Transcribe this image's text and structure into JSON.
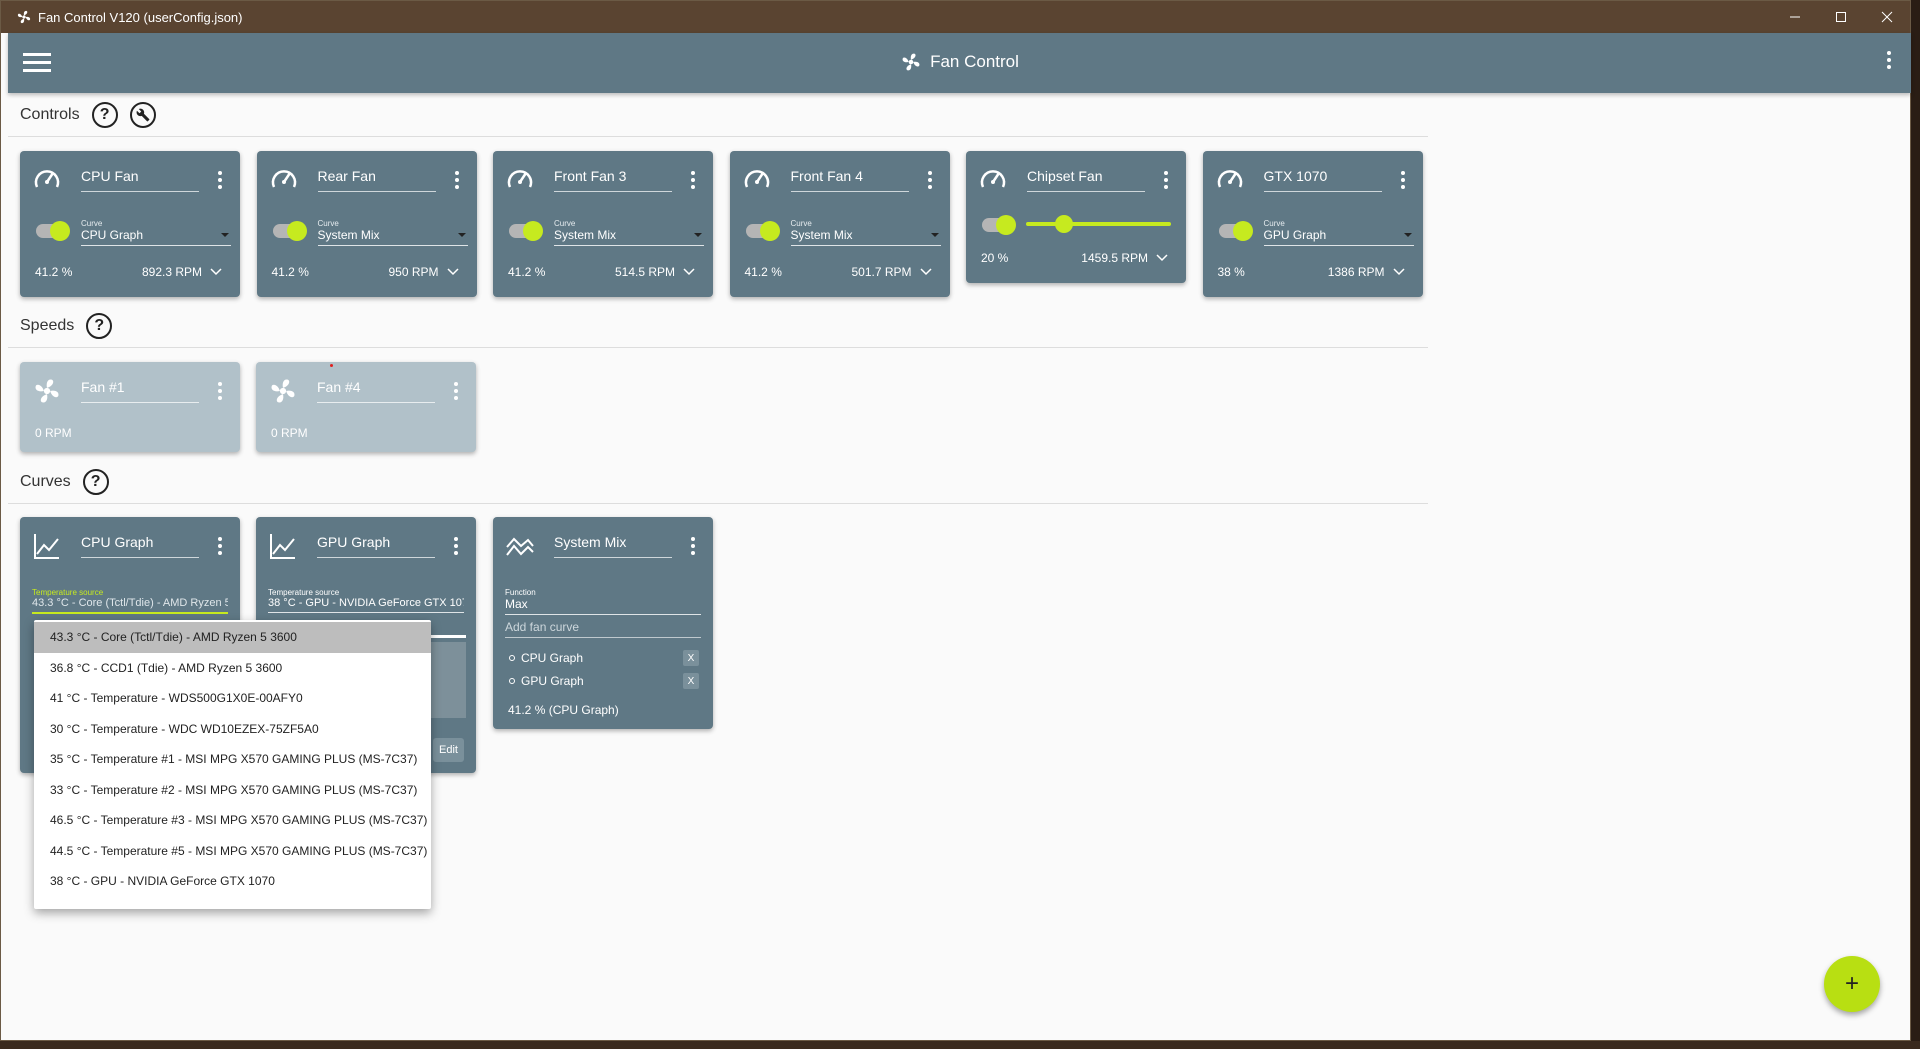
{
  "window": {
    "title": "Fan Control V120 (userConfig.json)"
  },
  "appbar": {
    "title": "Fan Control"
  },
  "sections": {
    "controls": "Controls",
    "speeds": "Speeds",
    "curves": "Curves"
  },
  "controls": [
    {
      "name": "CPU Fan",
      "curve_caption": "Curve",
      "curve": "CPU Graph",
      "percent": "41.2 %",
      "rpm": "892.3 RPM"
    },
    {
      "name": "Rear Fan",
      "curve_caption": "Curve",
      "curve": "System Mix",
      "percent": "41.2 %",
      "rpm": "950 RPM"
    },
    {
      "name": "Front Fan 3",
      "curve_caption": "Curve",
      "curve": "System Mix",
      "percent": "41.2 %",
      "rpm": "514.5 RPM"
    },
    {
      "name": "Front Fan 4",
      "curve_caption": "Curve",
      "curve": "System Mix",
      "percent": "41.2 %",
      "rpm": "501.7 RPM"
    },
    {
      "name": "Chipset Fan",
      "percent": "20 %",
      "rpm": "1459.5 RPM",
      "slider_fraction": 0.2
    },
    {
      "name": "GTX 1070",
      "curve_caption": "Curve",
      "curve": "GPU Graph",
      "percent": "38 %",
      "rpm": "1386 RPM"
    }
  ],
  "speeds": [
    {
      "name": "Fan #1",
      "rpm": "0 RPM"
    },
    {
      "name": "Fan #4",
      "rpm": "0 RPM"
    }
  ],
  "curves": {
    "cpu_graph": {
      "name": "CPU Graph",
      "source_caption": "Temperature source",
      "source": "43.3 °C - Core (Tctl/Tdie) - AMD Ryzen 5 3600"
    },
    "gpu_graph": {
      "name": "GPU Graph",
      "source_caption": "Temperature source",
      "source": "38 °C - GPU - NVIDIA GeForce GTX 1070",
      "edit_label": "Edit"
    },
    "system_mix": {
      "name": "System Mix",
      "function_caption": "Function",
      "function": "Max",
      "add_placeholder": "Add fan curve",
      "items": [
        "CPU Graph",
        "GPU Graph"
      ],
      "remove_label": "X",
      "output": "41.2 % (CPU Graph)"
    }
  },
  "dropdown": {
    "options": [
      "43.3 °C - Core (Tctl/Tdie) - AMD Ryzen 5 3600",
      "36.8 °C - CCD1 (Tdie) - AMD Ryzen 5 3600",
      "41 °C - Temperature - WDS500G1X0E-00AFY0",
      "30 °C - Temperature - WDC WD10EZEX-75ZF5A0",
      "35 °C - Temperature #1 - MSI MPG X570 GAMING PLUS (MS-7C37)",
      "33 °C - Temperature #2 - MSI MPG X570 GAMING PLUS (MS-7C37)",
      "46.5 °C - Temperature #3 - MSI MPG X570 GAMING PLUS (MS-7C37)",
      "44.5 °C - Temperature #5 - MSI MPG X570 GAMING PLUS (MS-7C37)",
      "38 °C - GPU - NVIDIA GeForce GTX 1070"
    ],
    "selected_index": 0
  },
  "fab": {
    "label": "+"
  },
  "colors": {
    "accent": "#c6ea1f",
    "card": "#5f7885",
    "card_disabled": "#b1c1c9",
    "titlebar": "#5a4431"
  }
}
